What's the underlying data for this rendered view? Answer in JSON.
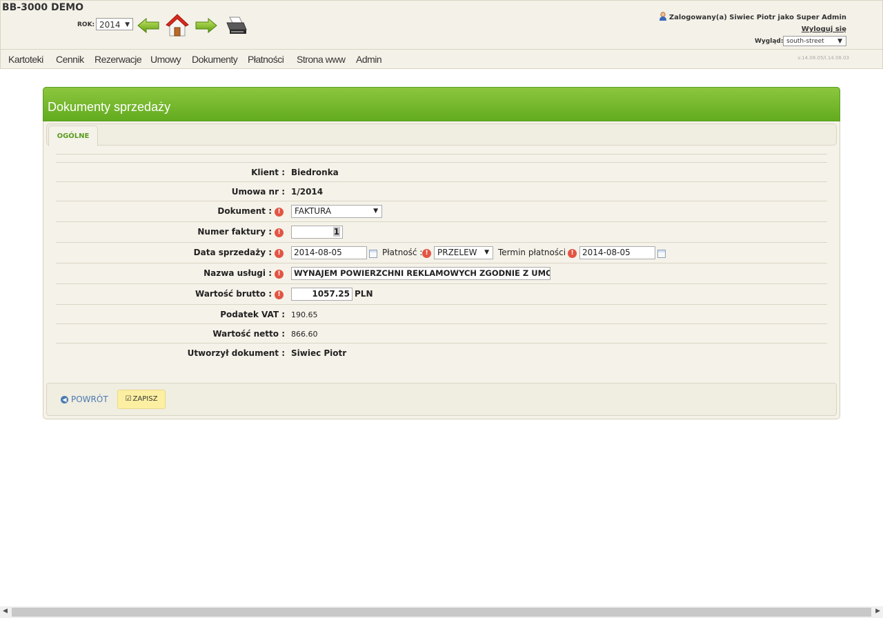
{
  "header": {
    "app_title": "BB-3000 DEMO",
    "year_label": "ROK:",
    "year_value": "2014",
    "user_text": "Zalogowany(a) Siwiec Piotr jako Super Admin",
    "logout_label": "Wyloguj się",
    "theme_label": "Wygląd:",
    "theme_value": "south-street"
  },
  "menu": {
    "items": [
      "Kartoteki",
      "Cennik",
      "Rezerwacje",
      "Umowy",
      "Dokumenty",
      "Płatności",
      "Strona www",
      "Admin"
    ],
    "version": "v.14.08.05/l.14.08.03"
  },
  "panel": {
    "title": "Dokumenty sprzedaży",
    "tab_label": "OGÓLNE"
  },
  "form": {
    "klient_label": "Klient :",
    "klient_value": "Biedronka",
    "umowa_label": "Umowa nr :",
    "umowa_value": "1/2014",
    "dokument_label": "Dokument :",
    "dokument_value": "FAKTURA",
    "numer_label": "Numer faktury :",
    "numer_value": "1",
    "data_label": "Data sprzedaży :",
    "data_value": "2014-08-05",
    "platnosc_label": "Płatność :",
    "platnosc_value": "PRZELEW",
    "termin_label": "Termin płatności :",
    "termin_value": "2014-08-05",
    "nazwa_label": "Nazwa usługi :",
    "nazwa_value": "WYNAJEM POWIERZCHNI REKLAMOWYCH ZGODNIE Z UMOWĄ NI",
    "brutto_label": "Wartość brutto :",
    "brutto_value": "1057.25",
    "currency": "PLN",
    "vat_label": "Podatek VAT :",
    "vat_value": "190.65",
    "netto_label": "Wartość netto :",
    "netto_value": "866.60",
    "utworzyl_label": "Utworzył dokument :",
    "utworzyl_value": "Siwiec Piotr"
  },
  "footer": {
    "back_label": "POWRÓT",
    "save_label": "ZAPISZ"
  },
  "colors": {
    "header_bg": "#f4f1e8",
    "panel_header_green": "#6ab42a",
    "tab_text_green": "#5a9c20",
    "required_icon": "#e25544",
    "back_link": "#4a7ab0",
    "save_button": "#fcefa1"
  }
}
